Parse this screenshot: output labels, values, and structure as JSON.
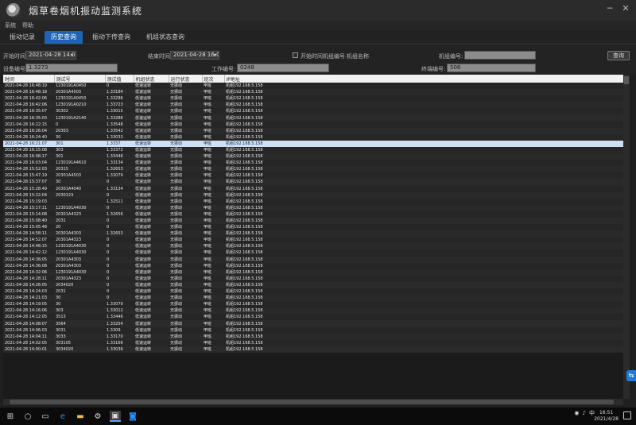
{
  "window": {
    "title": "烟草卷烟机振动监测系统"
  },
  "menu": [
    "系统",
    "帮助"
  ],
  "tabs": [
    {
      "label": "振动记录",
      "active": false
    },
    {
      "label": "历史查询",
      "active": true
    },
    {
      "label": "振动下传查询",
      "active": false
    },
    {
      "label": "机组状态查询",
      "active": false
    }
  ],
  "filters": {
    "start_label": "开始时间:",
    "start_value": "2021-04-28 14:00",
    "end_label": "结束时间:",
    "end_value": "2021-04-28 16:00",
    "cb1_label": "开始时间",
    "cb2_label": "机组编号",
    "cb3_label": "机组名称",
    "unit_label": "机组编号:",
    "unit_value": "",
    "device_label": "设备编号:",
    "device_value": "1.3273",
    "worker_label": "工作编号:",
    "worker_value": "0248",
    "terminal_label": "终端编号:",
    "terminal_value": "508",
    "query_label": "查询"
  },
  "table": {
    "columns": [
      "时间",
      "测试号",
      "测试值",
      "机组状态",
      "运行状态",
      "班次",
      "IP地址"
    ],
    "rows": [
      [
        "2021-04-28 16:48:19",
        "1230191A0450",
        "0",
        "低速运转",
        "无振动",
        "甲班",
        "机组192.168.5.158"
      ],
      [
        "2021-04-28 16:48:18",
        "20301A4503",
        "1.33184",
        "低速运转",
        "无振动",
        "甲班",
        "机组192.168.5.158"
      ],
      [
        "2021-04-28 16:42:06",
        "1230191A0450",
        "1.33286",
        "低速运转",
        "无振动",
        "甲班",
        "机组192.168.5.158"
      ],
      [
        "2021-04-28 16:42:06",
        "1230191A0210",
        "1.33723",
        "低速运转",
        "无振动",
        "甲班",
        "机组192.168.5.158"
      ],
      [
        "2021-04-28 16:35:07",
        "30302",
        "1.33015",
        "低速运转",
        "无振动",
        "甲班",
        "机组192.168.5.158"
      ],
      [
        "2021-04-28 16:35:03",
        "1230191A2140",
        "1.33286",
        "低速运转",
        "无振动",
        "甲班",
        "机组192.168.5.158"
      ],
      [
        "2021-04-28 16:22:15",
        "0",
        "1.33548",
        "低速运转",
        "无振动",
        "甲班",
        "机组192.168.5.158"
      ],
      [
        "2021-04-28 16:26:04",
        "20303",
        "1.33542",
        "低速运转",
        "无振动",
        "甲班",
        "机组192.168.5.158"
      ],
      [
        "2021-04-28 16:24:40",
        "30",
        "1.33033",
        "低速运转",
        "无振动",
        "甲班",
        "机组192.168.5.158"
      ],
      [
        "2021-04-28 16:21:07",
        "301",
        "1.3337",
        "低速运转",
        "无振动",
        "甲班",
        "机组192.168.5.158"
      ],
      [
        "2021-04-28 16:15:08",
        "303",
        "1.33372",
        "低速运转",
        "无振动",
        "甲班",
        "机组192.168.5.158"
      ],
      [
        "2021-04-28 16:08:17",
        "301",
        "1.33446",
        "低速运转",
        "无振动",
        "甲班",
        "机组192.168.5.158"
      ],
      [
        "2021-04-28 16:03:04",
        "1230191A4610",
        "1.33134",
        "低速运转",
        "无振动",
        "甲班",
        "机组192.168.5.158"
      ],
      [
        "2021-04-28 15:52:03",
        "20315",
        "1.32653",
        "低速运转",
        "无振动",
        "甲班",
        "机组192.168.5.158"
      ],
      [
        "2021-04-28 15:47:19",
        "20301A4503",
        "1.33079",
        "低速运转",
        "无振动",
        "甲班",
        "机组192.168.5.158"
      ],
      [
        "2021-04-28 15:37:07",
        "30",
        "0",
        "低速运转",
        "无振动",
        "甲班",
        "机组192.168.5.158"
      ],
      [
        "2021-04-28 15:28:49",
        "20301A4040",
        "1.33134",
        "低速运转",
        "无振动",
        "甲班",
        "机组192.168.5.158"
      ],
      [
        "2021-04-28 15:22:04",
        "2030123",
        "0",
        "低速运转",
        "无振动",
        "甲班",
        "机组192.168.5.158"
      ],
      [
        "2021-04-28 15:19:03",
        "",
        "1.32511",
        "低速运转",
        "无振动",
        "甲班",
        "机组192.168.5.158"
      ],
      [
        "2021-04-28 15:17:11",
        "1230191A4030",
        "0",
        "低速运转",
        "无振动",
        "甲班",
        "机组192.168.5.158"
      ],
      [
        "2021-04-28 15:14:08",
        "20301A4323",
        "1.32656",
        "低速运转",
        "无振动",
        "甲班",
        "机组192.168.5.158"
      ],
      [
        "2021-04-28 15:08:40",
        "2031",
        "0",
        "低速运转",
        "无振动",
        "甲班",
        "机组192.168.5.158"
      ],
      [
        "2021-04-28 15:05:48",
        "20",
        "0",
        "低速运转",
        "无振动",
        "甲班",
        "机组192.168.5.158"
      ],
      [
        "2021-04-28 14:58:11",
        "20301A4303",
        "1.32653",
        "低速运转",
        "无振动",
        "甲班",
        "机组192.168.5.158"
      ],
      [
        "2021-04-28 14:52:07",
        "20301A4323",
        "0",
        "低速运转",
        "无振动",
        "甲班",
        "机组192.168.5.158"
      ],
      [
        "2021-04-28 14:48:15",
        "1230191A4030",
        "0",
        "低速运转",
        "无振动",
        "甲班",
        "机组192.168.5.158"
      ],
      [
        "2021-04-28 14:42:12",
        "1230191A4030",
        "0",
        "低速运转",
        "无振动",
        "甲班",
        "机组192.168.5.158"
      ],
      [
        "2021-04-28 14:38:05",
        "20301A4303",
        "0",
        "低速运转",
        "无振动",
        "甲班",
        "机组192.168.5.158"
      ],
      [
        "2021-04-28 14:36:08",
        "20301A4303",
        "0",
        "低速运转",
        "无振动",
        "甲班",
        "机组192.168.5.158"
      ],
      [
        "2021-04-28 14:32:06",
        "1230191A4030",
        "0",
        "低速运转",
        "无振动",
        "甲班",
        "机组192.168.5.158"
      ],
      [
        "2021-04-28 14:28:11",
        "20301A4323",
        "0",
        "低速运转",
        "无振动",
        "甲班",
        "机组192.168.5.158"
      ],
      [
        "2021-04-28 14:26:05",
        "2034020",
        "0",
        "低速运转",
        "无振动",
        "甲班",
        "机组192.168.5.158"
      ],
      [
        "2021-04-28 14:24:03",
        "2031",
        "0",
        "低速运转",
        "无振动",
        "甲班",
        "机组192.168.5.158"
      ],
      [
        "2021-04-28 14:21:03",
        "30",
        "0",
        "低速运转",
        "无振动",
        "甲班",
        "机组192.168.5.158"
      ],
      [
        "2021-04-28 14:19:05",
        "30",
        "1.33079",
        "低速运转",
        "无振动",
        "甲班",
        "机组192.168.5.158"
      ],
      [
        "2021-04-28 14:16:06",
        "303",
        "1.33012",
        "低速运转",
        "无振动",
        "甲班",
        "机组192.168.5.158"
      ],
      [
        "2021-04-28 14:12:05",
        "3513",
        "1.33446",
        "低速运转",
        "无振动",
        "甲班",
        "机组192.168.5.158"
      ],
      [
        "2021-04-28 14:08:07",
        "3564",
        "1.33254",
        "低速运转",
        "无振动",
        "甲班",
        "机组192.168.5.158"
      ],
      [
        "2021-04-28 14:06:03",
        "3031",
        "1.3309",
        "低速运转",
        "无振动",
        "甲班",
        "机组192.168.5.158"
      ],
      [
        "2021-04-28 14:04:11",
        "3033",
        "1.33170",
        "低速运转",
        "无振动",
        "甲班",
        "机组192.168.5.158"
      ],
      [
        "2021-04-28 14:02:05",
        "303105",
        "1.33166",
        "低速运转",
        "无振动",
        "甲班",
        "机组192.168.5.158"
      ],
      [
        "2021-04-28 14:00:01",
        "3034020",
        "1.33036",
        "低速运转",
        "无振动",
        "甲班",
        "机组192.168.5.158"
      ]
    ],
    "selected_row": 9
  },
  "taskbar": {
    "icons": [
      "windows-start",
      "search",
      "task-view",
      "edge",
      "file-explorer",
      "settings",
      "app-active",
      "app-blue"
    ],
    "tray_text": "中",
    "time": "16:51",
    "date": "2021/4/28"
  },
  "side_button": "⇆"
}
